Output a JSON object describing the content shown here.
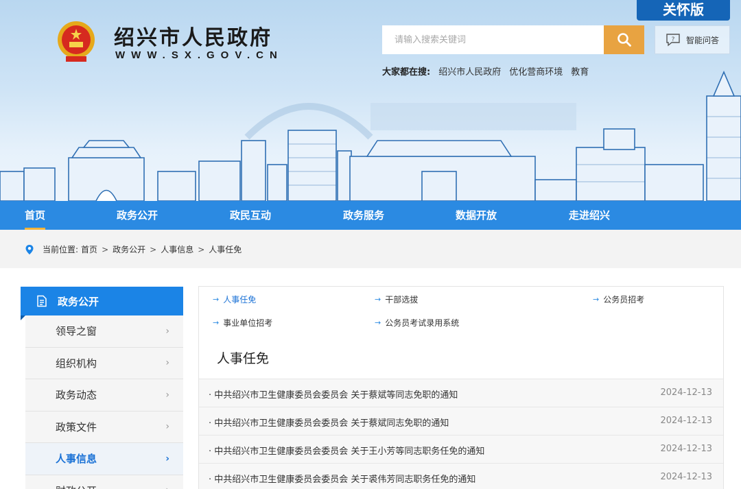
{
  "header": {
    "title": "绍兴市人民政府",
    "url": "WWW.SX.GOV.CN",
    "care_label": "关怀版",
    "search_placeholder": "请输入搜索关键词",
    "qa_label": "智能问答",
    "hot_label": "大家都在搜:",
    "hot_keywords": [
      "绍兴市人民政府",
      "优化营商环境",
      "教育"
    ]
  },
  "nav": [
    "首页",
    "政务公开",
    "政民互动",
    "政务服务",
    "数据开放",
    "走进绍兴"
  ],
  "breadcrumb": {
    "label": "当前位置:",
    "items": [
      "首页",
      "政务公开",
      "人事信息",
      "人事任免"
    ]
  },
  "sidebar": {
    "title": "政务公开",
    "items": [
      "领导之窗",
      "组织机构",
      "政务动态",
      "政策文件",
      "人事信息",
      "财政公开"
    ]
  },
  "subnav": [
    "人事任免",
    "干部选拔",
    "公务员招考",
    "事业单位招考",
    "公务员考试录用系统"
  ],
  "section_title": "人事任免",
  "list": [
    {
      "title": "中共绍兴市卫生健康委员会委员会 关于蔡斌等同志免职的通知",
      "date": "2024-12-13"
    },
    {
      "title": "中共绍兴市卫生健康委员会委员会 关于蔡斌同志免职的通知",
      "date": "2024-12-13"
    },
    {
      "title": "中共绍兴市卫生健康委员会委员会 关于王小芳等同志职务任免的通知",
      "date": "2024-12-13"
    },
    {
      "title": "中共绍兴市卫生健康委员会委员会 关于裘伟芳同志职务任免的通知",
      "date": "2024-12-13"
    }
  ],
  "colors": {
    "nav": "#2b8ae2",
    "accent": "#e8a341",
    "sidebar_head": "#1b84e6",
    "care": "#1565b7"
  },
  "icons": {
    "search": "search-icon",
    "qa": "chat-question-icon",
    "location": "location-pin-icon",
    "doc": "document-icon",
    "emblem": "national-emblem-icon"
  }
}
